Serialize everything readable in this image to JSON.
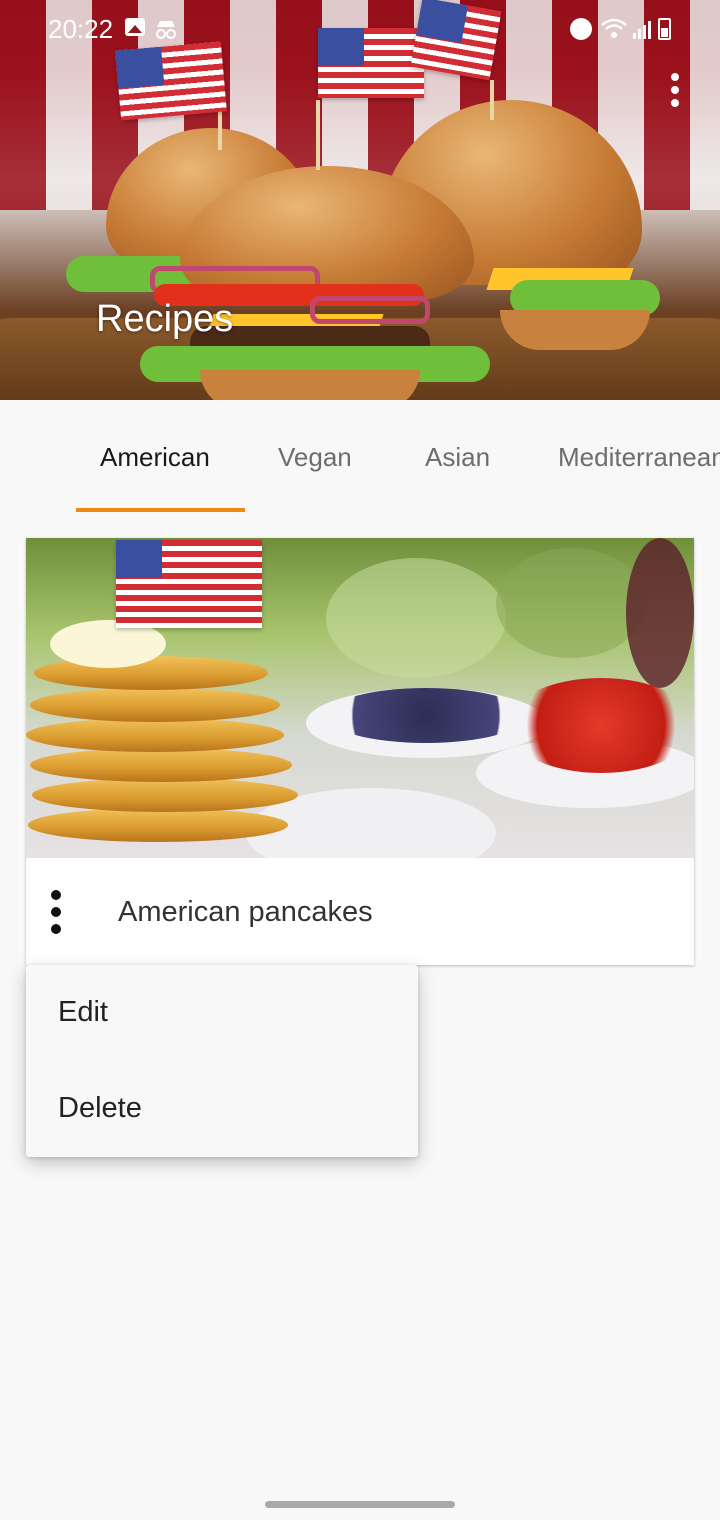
{
  "status_bar": {
    "time": "20:22"
  },
  "header": {
    "title": "Recipes"
  },
  "tabs": [
    {
      "label": "American",
      "active": true
    },
    {
      "label": "Vegan",
      "active": false
    },
    {
      "label": "Asian",
      "active": false
    },
    {
      "label": "Mediterranean",
      "active": false
    }
  ],
  "recipes": [
    {
      "name": "American pancakes"
    }
  ],
  "popup_menu": {
    "items": [
      "Edit",
      "Delete"
    ]
  },
  "colors": {
    "accent": "#ef8a17",
    "background": "#f8f8f8"
  },
  "icons": [
    "image-icon",
    "incognito-icon",
    "alarm-icon",
    "wifi-icon",
    "signal-icon",
    "battery-icon",
    "more-vert-icon"
  ]
}
